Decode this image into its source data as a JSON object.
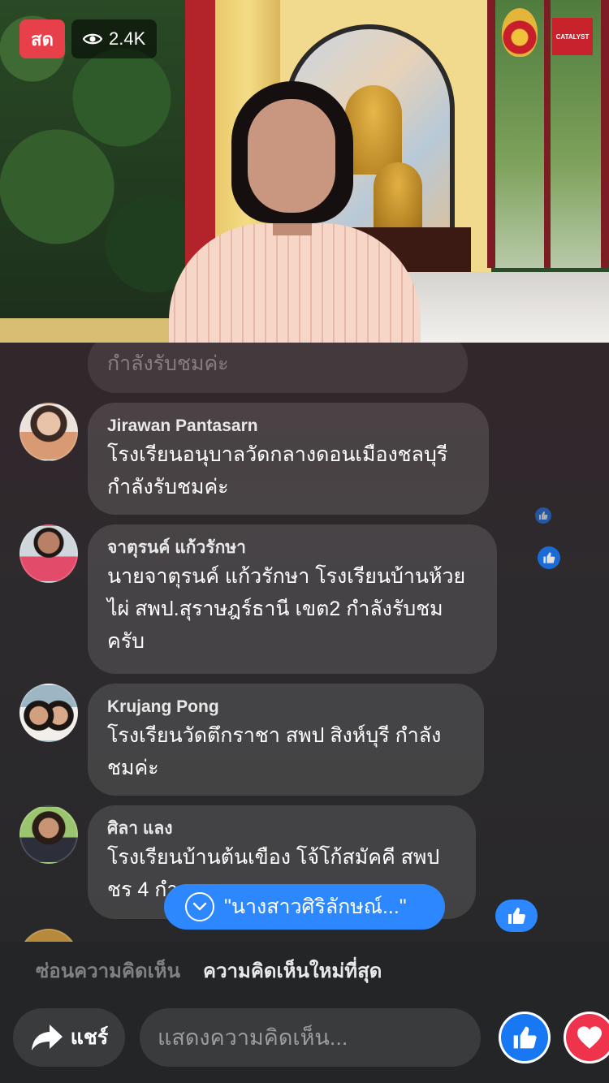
{
  "stream": {
    "live_label": "สด",
    "viewer_count": "2.4K",
    "logo_text": "CATALYST"
  },
  "comments": [
    {
      "name": "",
      "text": "กำลังรับชมค่ะ"
    },
    {
      "name": "Jirawan Pantasarn",
      "text": "โรงเรียนอนุบาลวัดกลางดอนเมืองชลบุรี กำลังรับชมค่ะ"
    },
    {
      "name": "จาตุรนค์ แก้วรักษา",
      "text": "นายจาตุรนค์ แก้วรักษา โรงเรียนบ้านห้วยไผ่ สพป.สุราษฎร์ธานี เขต2 กำลังรับชมครับ"
    },
    {
      "name": "Krujang Pong",
      "text": "โรงเรียนวัดตึกราชา สพป สิงห์บุรี กำลังชมค่ะ"
    },
    {
      "name": "ศิลา แลง",
      "text": "โรงเรียนบ้านต้นเขือง โจ้โก้สมัคคี สพป ชร 4 กำ"
    }
  ],
  "new_comment_pill": "\"นางสาวศิริลักษณ์...\"",
  "filters": {
    "hide_label": "ซ่อนความคิดเห็น",
    "newest_label": "ความคิดเห็นใหม่ที่สุด"
  },
  "bottom_bar": {
    "share_label": "แชร์",
    "comment_placeholder": "แสดงความคิดเห็น..."
  },
  "colors": {
    "live_red": "#e8404a",
    "facebook_blue": "#1877f2",
    "love_red": "#f0334d"
  }
}
